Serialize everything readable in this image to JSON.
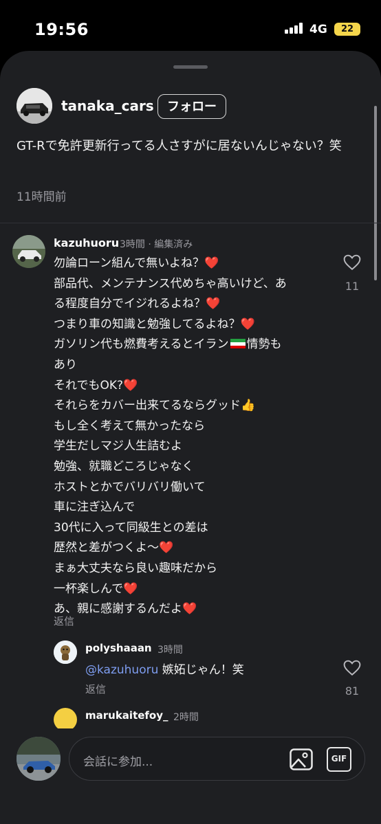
{
  "status": {
    "time": "19:56",
    "network": "4G",
    "battery": "22"
  },
  "post": {
    "username": "tanaka_cars",
    "follow_label": "フォロー",
    "text": "GT-Rで免許更新行ってる人さすがに居ないんじゃない？笑",
    "time": "11時間前"
  },
  "comment": {
    "username": "kazuhuoru",
    "meta": "3時間 · 編集済み",
    "likes": "11",
    "reply_label": "返信",
    "lines": [
      {
        "text": "勿論ローン組んで無いよね？",
        "emoji": "❤️",
        "kind": "heart"
      },
      {
        "text": "部品代、メンテナンス代めちゃ高いけど、あ",
        "emoji": "",
        "kind": ""
      },
      {
        "text": "る程度自分でイジれるよね？",
        "emoji": "❤️",
        "kind": "heart"
      },
      {
        "text": "つまり車の知識と勉強してるよね？",
        "emoji": "❤️",
        "kind": "heart"
      },
      {
        "text": "ガソリン代も燃費考えるとイラン",
        "emoji": "🇮🇷",
        "after": "情勢も",
        "kind": "flag"
      },
      {
        "text": "あり",
        "emoji": "",
        "kind": ""
      },
      {
        "text": "それでもOK?",
        "emoji": "❤️",
        "kind": "heart"
      },
      {
        "text": "それらをカバー出来てるならグッド",
        "emoji": "👍",
        "kind": "thumb"
      },
      {
        "text": "もし全く考えて無かったなら",
        "emoji": "",
        "kind": ""
      },
      {
        "text": "学生だしマジ人生詰むよ",
        "emoji": "",
        "kind": ""
      },
      {
        "text": "勉強、就職どころじゃなく",
        "emoji": "",
        "kind": ""
      },
      {
        "text": "ホストとかでバリバリ働いて",
        "emoji": "",
        "kind": ""
      },
      {
        "text": "車に注ぎ込んで",
        "emoji": "",
        "kind": ""
      },
      {
        "text": "30代に入って同級生との差は",
        "emoji": "",
        "kind": ""
      },
      {
        "text": "歴然と差がつくよ〜",
        "emoji": "❤️",
        "kind": "heart"
      },
      {
        "text": "まぁ大丈夫なら良い趣味だから",
        "emoji": "",
        "kind": ""
      },
      {
        "text": "一杯楽しんで",
        "emoji": "❤️",
        "kind": "heart"
      },
      {
        "text": "あ、親に感謝するんだよ",
        "emoji": "❤️",
        "kind": "heart"
      }
    ]
  },
  "reply": {
    "username": "polyshaaan",
    "meta": "3時間",
    "mention": "@kazuhuoru",
    "text": " 嫉妬じゃん！笑",
    "likes": "81",
    "reply_label": "返信"
  },
  "next_comment": {
    "username": "marukaitefoy_",
    "meta": "2時間"
  },
  "composer": {
    "placeholder": "会話に参加...",
    "gif_label": "GIF"
  },
  "colors": {
    "background": "#1e1f22",
    "heart": "#e8332f",
    "mention": "#7e9df0",
    "battery": "#f5d64b"
  }
}
